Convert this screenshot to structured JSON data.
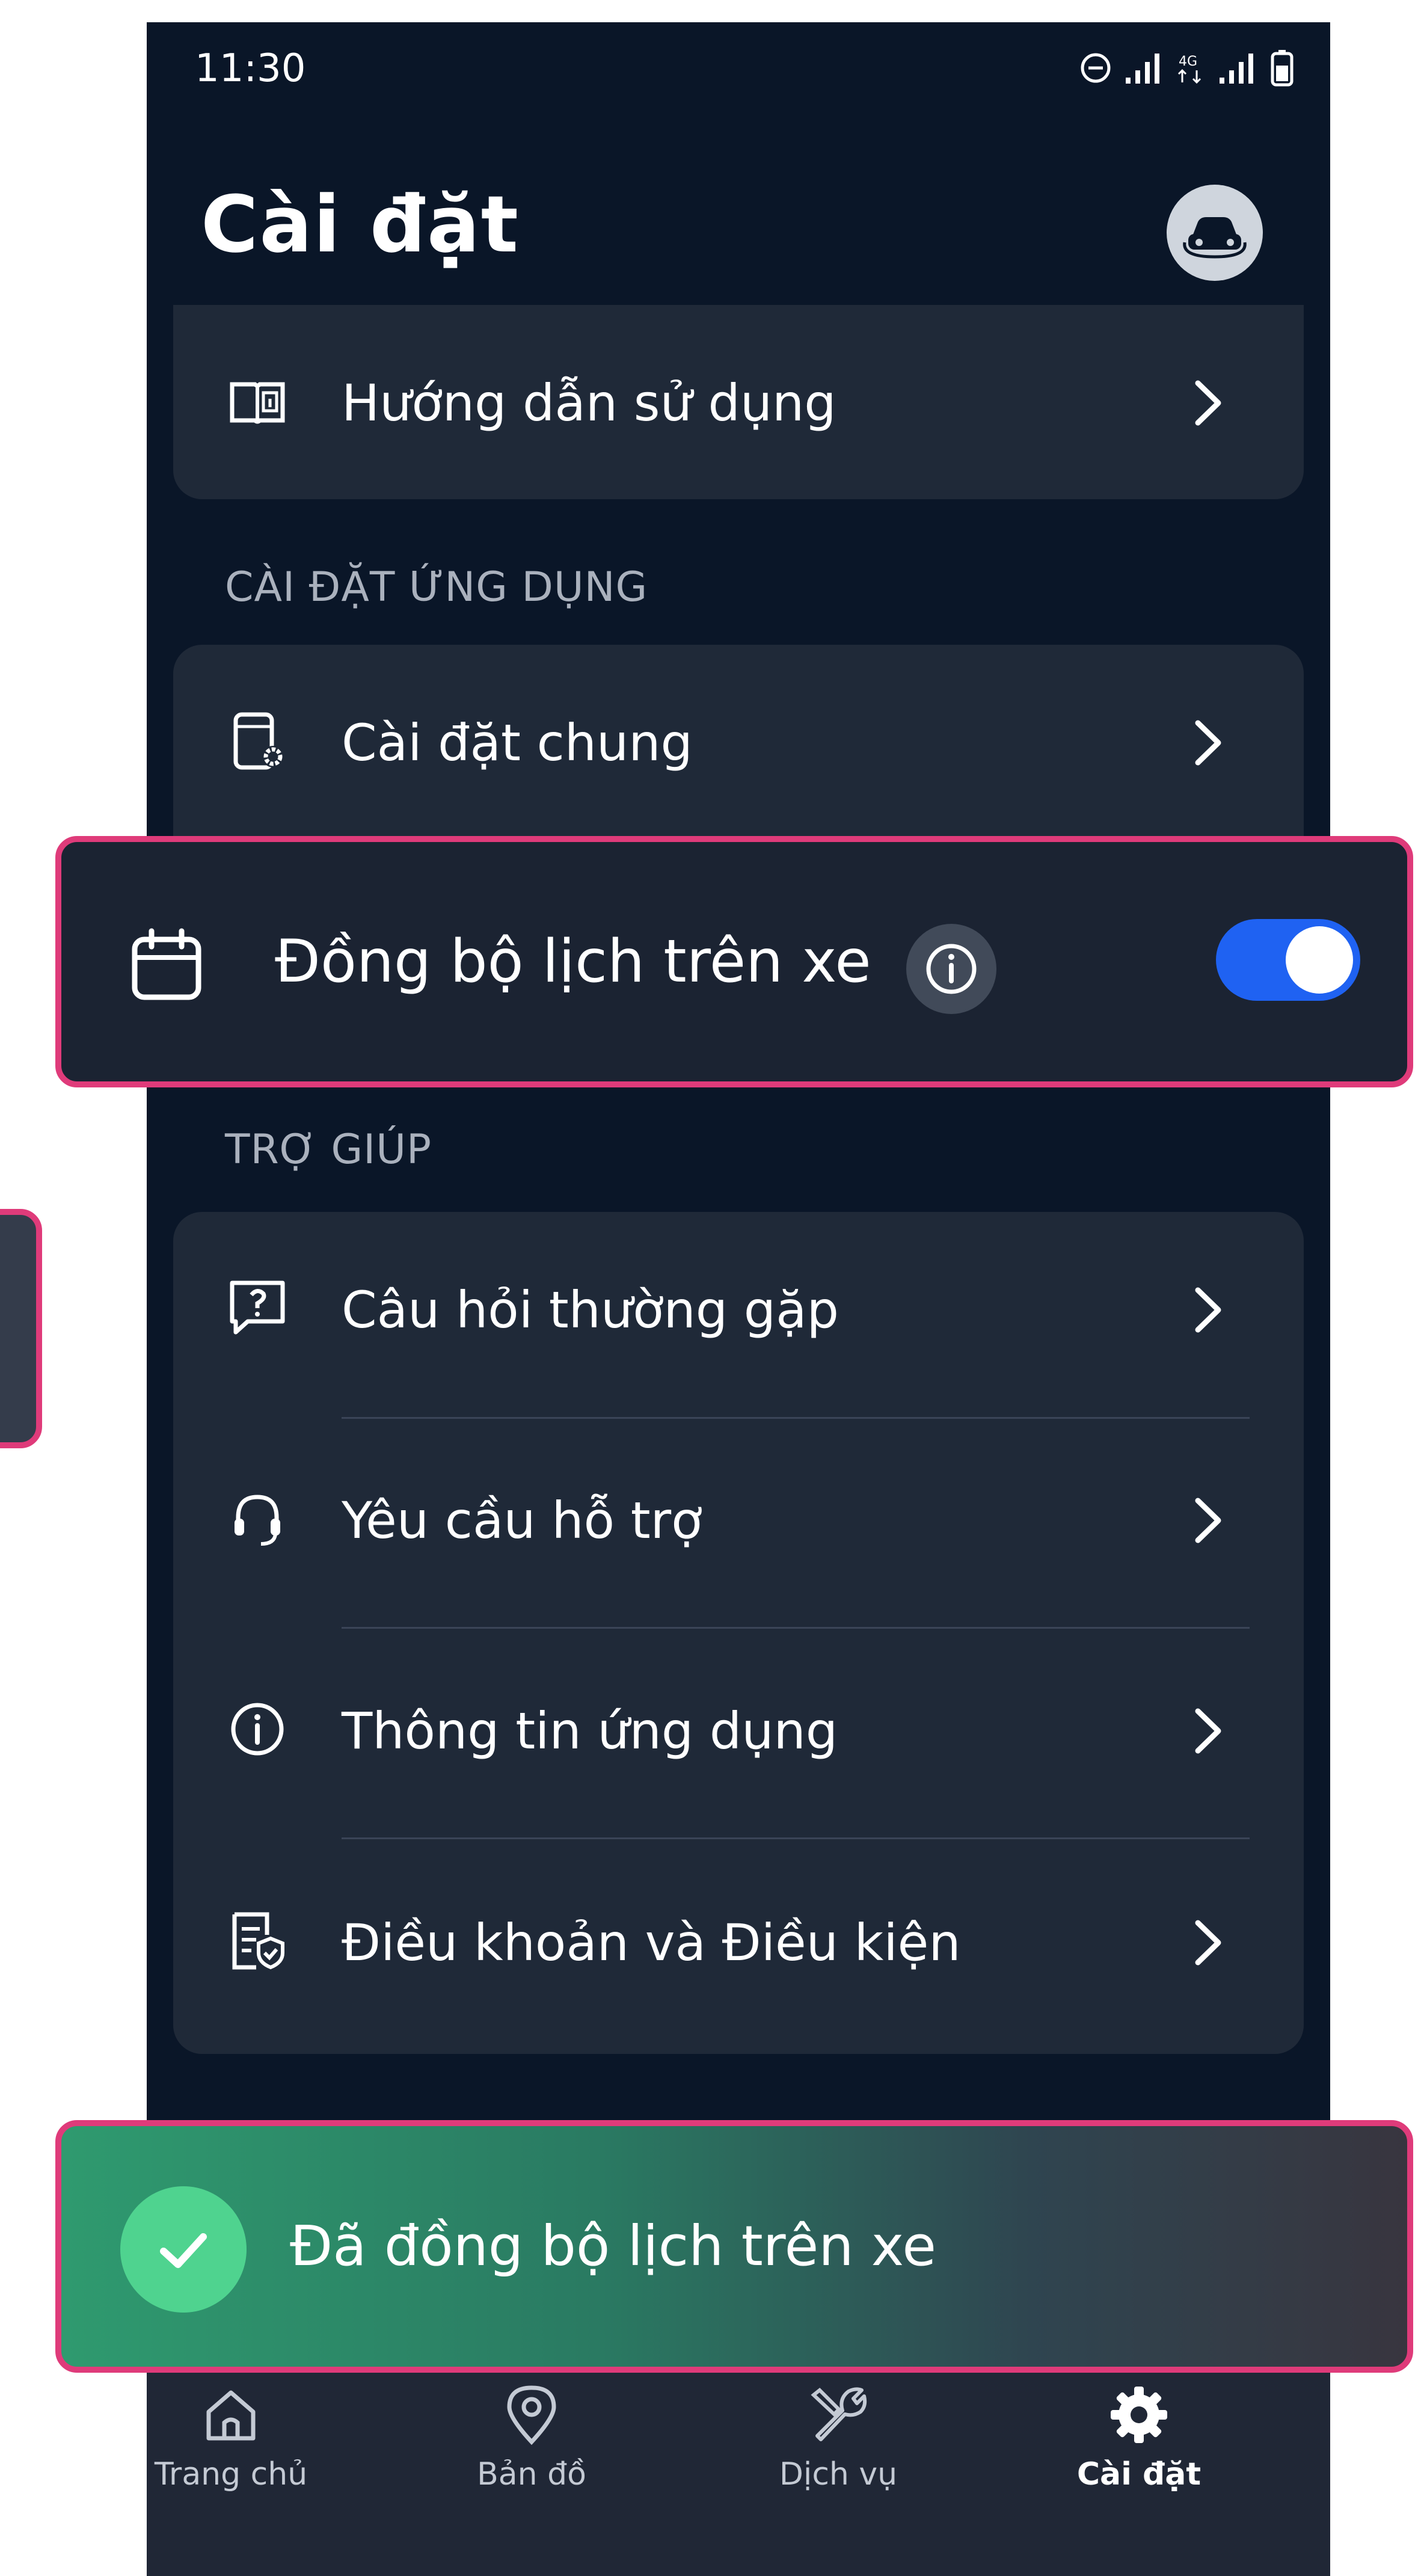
{
  "status_bar": {
    "time": "11:30"
  },
  "header": {
    "title": "Cài đặt"
  },
  "top_card": {
    "guide_label": "Hướng dẫn sử dụng"
  },
  "app_settings": {
    "section_label": "CÀI ĐẶT ỨNG DỤNG",
    "general_label": "Cài đặt chung"
  },
  "calendar_sync": {
    "label": "Đồng bộ lịch trên xe",
    "toggle_on": true,
    "toggle_color": "#1f62f2"
  },
  "help": {
    "section_label": "TRỢ GIÚP",
    "items": [
      {
        "label": "Câu hỏi thường gặp",
        "icon": "question-bubble-icon"
      },
      {
        "label": "Yêu cầu hỗ trợ",
        "icon": "headset-icon"
      },
      {
        "label": "Thông tin ứng dụng",
        "icon": "info-icon"
      },
      {
        "label": "Điều khoản và Điều kiện",
        "icon": "document-shield-icon"
      }
    ]
  },
  "toast": {
    "message": "Đã đồng bộ lịch trên xe"
  },
  "nav": {
    "items": [
      {
        "label": "Trang chủ",
        "icon": "home-icon",
        "active": false
      },
      {
        "label": "Bản đồ",
        "icon": "map-pin-icon",
        "active": false
      },
      {
        "label": "Dịch vụ",
        "icon": "wrench-screwdriver-icon",
        "active": false
      },
      {
        "label": "Cài đặt",
        "icon": "gear-icon",
        "active": true
      }
    ]
  },
  "colors": {
    "background": "#0a1628",
    "card": "#1f2938",
    "highlight_border": "#df3b7a",
    "toast_check": "#4fd38f"
  }
}
